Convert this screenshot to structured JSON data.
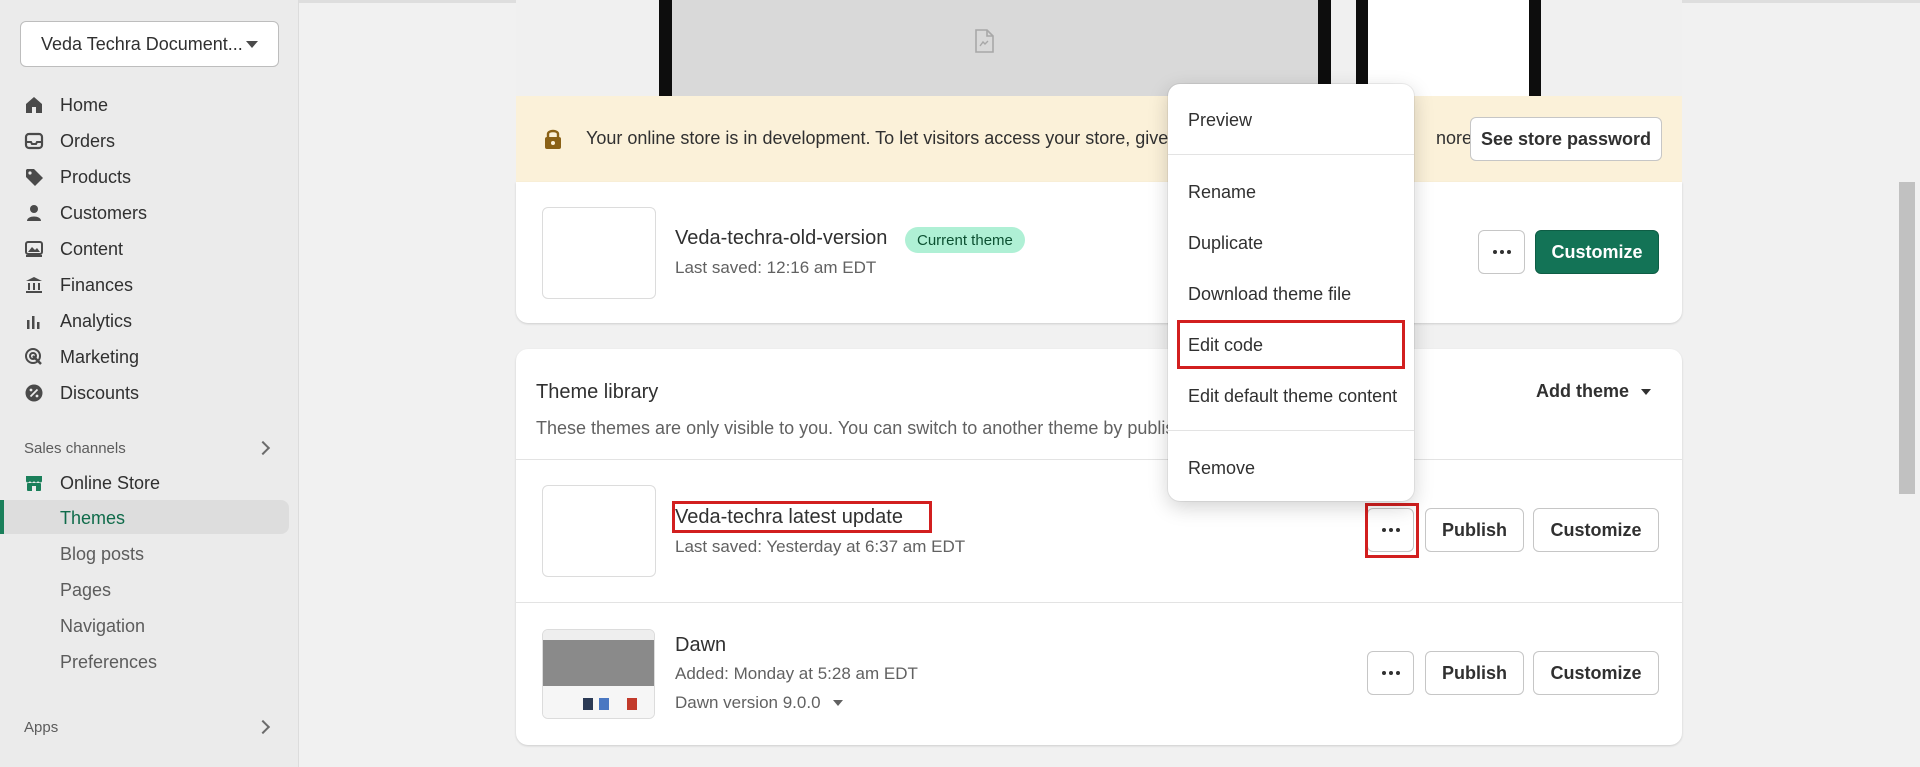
{
  "sidebar": {
    "store_name": "Veda Techra Document...",
    "nav": [
      {
        "label": "Home",
        "icon": "home-icon"
      },
      {
        "label": "Orders",
        "icon": "inbox-icon"
      },
      {
        "label": "Products",
        "icon": "tag-icon"
      },
      {
        "label": "Customers",
        "icon": "person-icon"
      },
      {
        "label": "Content",
        "icon": "image-icon"
      },
      {
        "label": "Finances",
        "icon": "bank-icon"
      },
      {
        "label": "Analytics",
        "icon": "bar-chart-icon"
      },
      {
        "label": "Marketing",
        "icon": "target-icon"
      },
      {
        "label": "Discounts",
        "icon": "discount-icon"
      }
    ],
    "sales_channels_label": "Sales channels",
    "online_store_label": "Online Store",
    "online_store_items": [
      "Themes",
      "Blog posts",
      "Pages",
      "Navigation",
      "Preferences"
    ],
    "apps_label": "Apps"
  },
  "banner": {
    "text": "Your online store is in development. To let visitors access your store, give the",
    "trailing_text": "nore",
    "button": "See store password"
  },
  "current_theme": {
    "name": "Veda-techra-old-version",
    "badge": "Current theme",
    "last_saved": "Last saved: 12:16 am EDT",
    "customize_label": "Customize"
  },
  "library": {
    "title": "Theme library",
    "description": "These themes are only visible to you. You can switch to another theme by publishi",
    "add_theme_label": "Add theme",
    "themes": [
      {
        "name": "Veda-techra latest update",
        "meta": "Last saved: Yesterday at 6:37 am EDT",
        "publish_label": "Publish",
        "customize_label": "Customize"
      },
      {
        "name": "Dawn",
        "meta": "Added: Monday at 5:28 am EDT",
        "version": "Dawn version 9.0.0",
        "publish_label": "Publish",
        "customize_label": "Customize"
      }
    ]
  },
  "menu": {
    "items": [
      "Preview",
      "Rename",
      "Duplicate",
      "Download theme file",
      "Edit code",
      "Edit default theme content",
      "Remove"
    ]
  },
  "colors": {
    "primary_green": "#137356",
    "badge_bg": "#aff0d5",
    "banner_bg": "#fbf1d9",
    "highlight_red": "#d21f1f"
  }
}
